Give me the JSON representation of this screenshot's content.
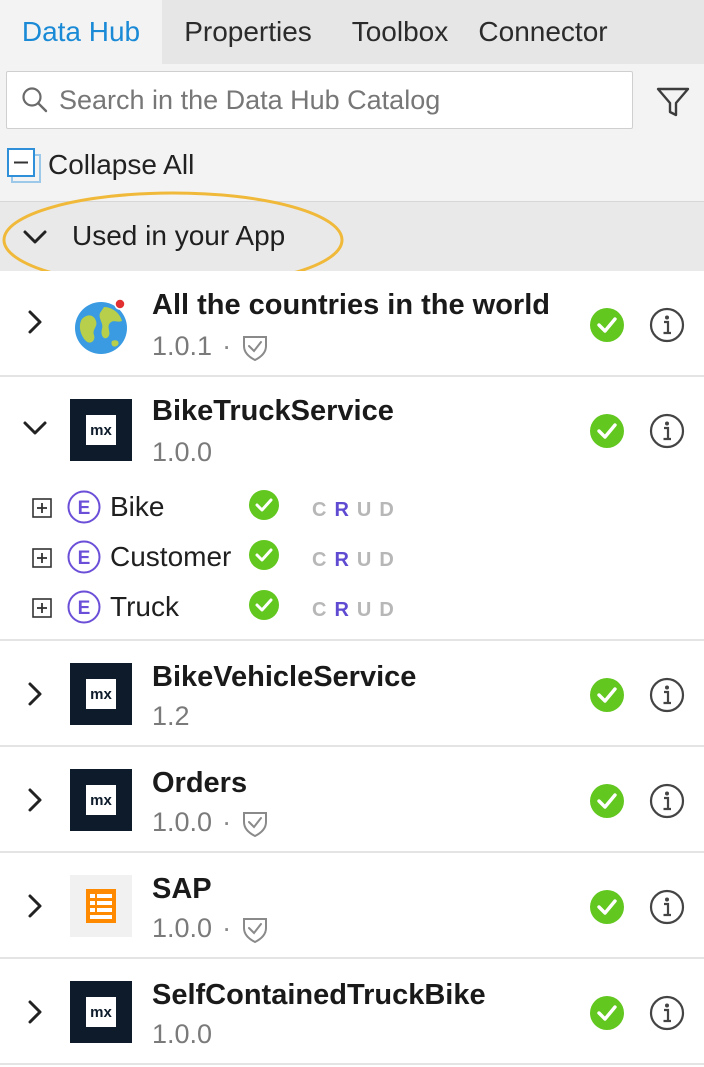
{
  "tabs": [
    {
      "label": "Data Hub",
      "active": true
    },
    {
      "label": "Properties",
      "active": false
    },
    {
      "label": "Toolbox",
      "active": false
    },
    {
      "label": "Connector",
      "active": false
    }
  ],
  "search": {
    "placeholder": "Search in the Data Hub Catalog",
    "value": ""
  },
  "collapse_label": "Collapse All",
  "section": {
    "title": "Used in your App",
    "highlight_color": "#f0b93a"
  },
  "colors": {
    "accent": "#1a8ad6",
    "check": "#62c71f",
    "crud_active": "#5f4bd1",
    "mx_logo": "#0d1b2a",
    "sap_logo": "#ff8a00"
  },
  "items": [
    {
      "title": "All the countries in the world",
      "version": "1.0.1",
      "dot": "·",
      "logo": "globe-icon"
    },
    {
      "title": "BikeTruckService",
      "version": "1.0.0",
      "logo": "mx-logo-icon",
      "mx_text": "mx",
      "entities": [
        {
          "name": "Bike",
          "letter": "E",
          "crud": [
            "C",
            "R",
            "U",
            "D"
          ]
        },
        {
          "name": "Customer",
          "letter": "E",
          "crud": [
            "C",
            "R",
            "U",
            "D"
          ]
        },
        {
          "name": "Truck",
          "letter": "E",
          "crud": [
            "C",
            "R",
            "U",
            "D"
          ]
        }
      ]
    },
    {
      "title": "BikeVehicleService",
      "version": "1.2",
      "logo": "mx-logo-icon",
      "mx_text": "mx"
    },
    {
      "title": "Orders",
      "version": "1.0.0",
      "dot": "·",
      "logo": "mx-logo-icon",
      "mx_text": "mx"
    },
    {
      "title": "SAP",
      "version": "1.0.0",
      "dot": "·",
      "logo": "sap-logo-icon"
    },
    {
      "title": "SelfContainedTruckBike",
      "version": "1.0.0",
      "logo": "mx-logo-icon",
      "mx_text": "mx"
    }
  ]
}
